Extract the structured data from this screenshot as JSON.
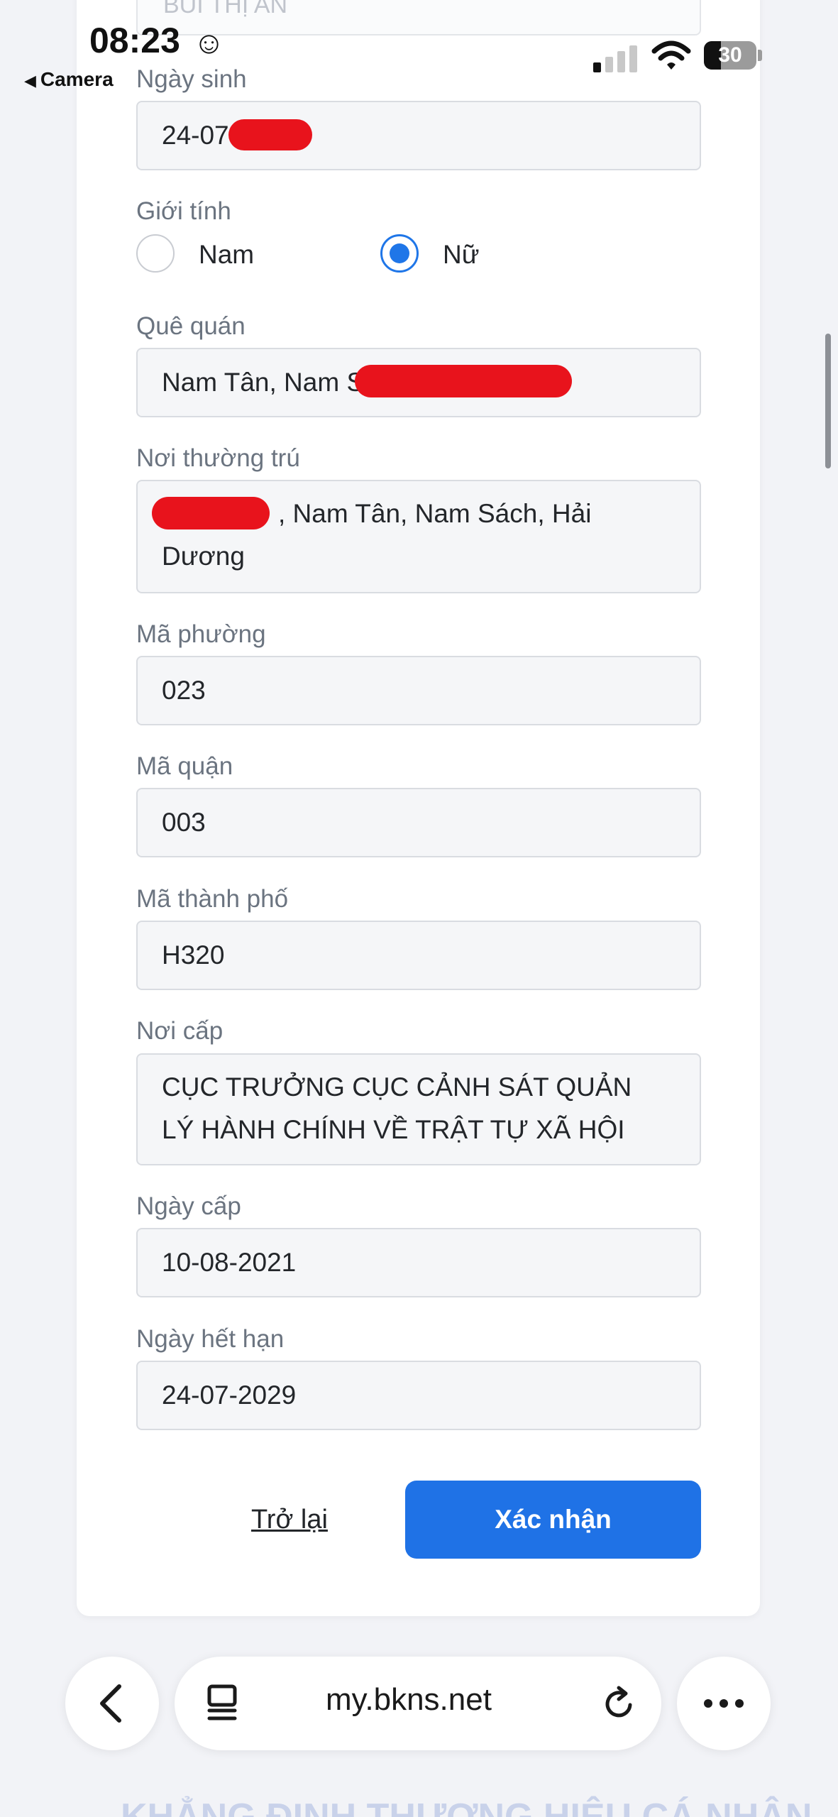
{
  "status_bar": {
    "time": "08:23",
    "back_app": "Camera",
    "battery": "30"
  },
  "form": {
    "top_partial_value": "BÙI THỊ AN",
    "fields": {
      "birth_date": {
        "label": "Ngày sinh",
        "value": "24-07-"
      },
      "gender": {
        "label": "Giới tính",
        "options": [
          "Nam",
          "Nữ"
        ],
        "selected": "Nữ"
      },
      "hometown": {
        "label": "Quê quán",
        "value": "Nam Tân, Nam S"
      },
      "residence": {
        "label": "Nơi thường trú",
        "value_line1": ", Nam Tân, Nam Sách, Hải",
        "value_line2": "Dương"
      },
      "ward_code": {
        "label": "Mã phường",
        "value": "023"
      },
      "district_code": {
        "label": "Mã quận",
        "value": "003"
      },
      "city_code": {
        "label": "Mã thành phố",
        "value": "H320"
      },
      "issued_by": {
        "label": "Nơi cấp",
        "value_line1": "CỤC TRƯỞNG CỤC CẢNH SÁT QUẢN",
        "value_line2": "LÝ HÀNH CHÍNH VỀ TRẬT TỰ XÃ HỘI"
      },
      "issue_date": {
        "label": "Ngày cấp",
        "value": "10-08-2021"
      },
      "expiry_date": {
        "label": "Ngày hết hạn",
        "value": "24-07-2029"
      }
    },
    "actions": {
      "back_label": "Trở lại",
      "confirm_label": "Xác nhận"
    }
  },
  "browser": {
    "url": "my.bkns.net",
    "icons": [
      "chevron-left-icon",
      "tabs-icon",
      "reload-icon",
      "more-icon"
    ]
  },
  "footer_partial_text": "KHẲNG ĐỊNH THƯƠNG HIỆU CÁ NHÂN",
  "colors": {
    "accent": "#1f72e6",
    "redaction": "#e8131c"
  }
}
